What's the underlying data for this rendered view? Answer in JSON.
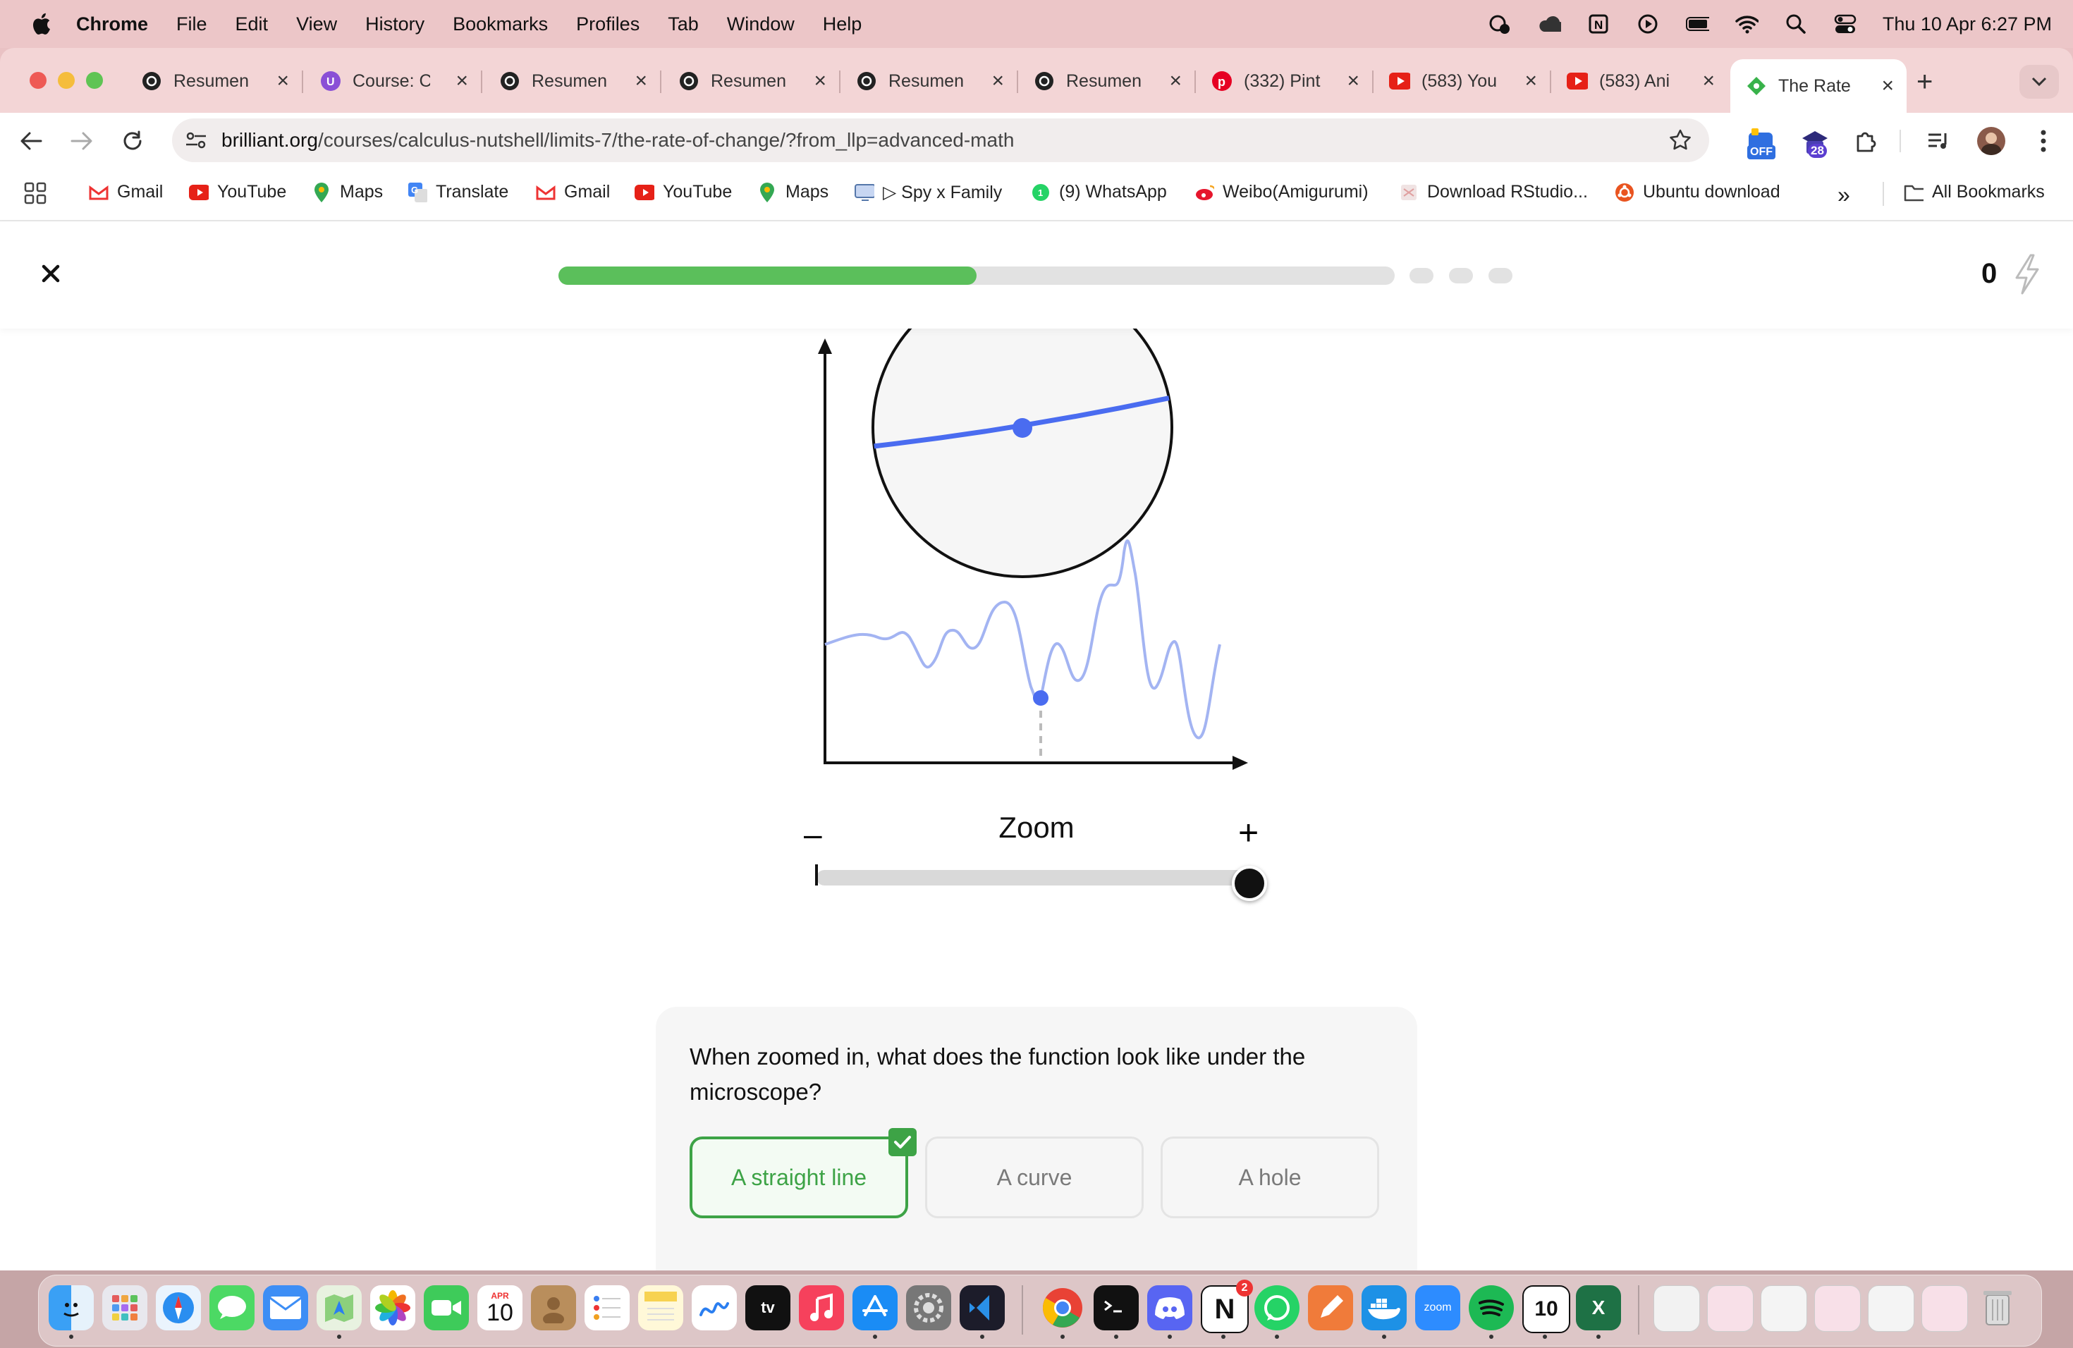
{
  "menubar": {
    "app_name": "Chrome",
    "items": [
      "File",
      "Edit",
      "View",
      "History",
      "Bookmarks",
      "Profiles",
      "Tab",
      "Window",
      "Help"
    ],
    "datetime": "Thu 10 Apr  6:27 PM"
  },
  "tabs": [
    {
      "title": "Resumen",
      "icon": "chatgpt-icon"
    },
    {
      "title": "Course: C",
      "icon": "udemy-icon"
    },
    {
      "title": "Resumen",
      "icon": "chatgpt-icon"
    },
    {
      "title": "Resumen",
      "icon": "chatgpt-icon"
    },
    {
      "title": "Resumen",
      "icon": "chatgpt-icon"
    },
    {
      "title": "Resumen",
      "icon": "chatgpt-icon"
    },
    {
      "title": "(332) Pint",
      "icon": "pinterest-icon"
    },
    {
      "title": "(583) You",
      "icon": "youtube-icon"
    },
    {
      "title": "(583) Ani",
      "icon": "youtube-icon"
    },
    {
      "title": "The Rate",
      "icon": "brilliant-icon",
      "active": true
    }
  ],
  "address": {
    "domain": "brilliant.org",
    "path": "/courses/calculus-nutshell/limits-7/the-rate-of-change/?from_llp=advanced-math"
  },
  "extensions": {
    "badge_off": "OFF",
    "badge_count": "28"
  },
  "bookmarks": [
    {
      "label": "Gmail",
      "icon": "gmail-icon"
    },
    {
      "label": "YouTube",
      "icon": "youtube-icon"
    },
    {
      "label": "Maps",
      "icon": "maps-icon"
    },
    {
      "label": "Translate",
      "icon": "translate-icon"
    },
    {
      "label": "Gmail",
      "icon": "gmail-icon"
    },
    {
      "label": "YouTube",
      "icon": "youtube-icon"
    },
    {
      "label": "Maps",
      "icon": "maps-icon"
    },
    {
      "label": "▷ Spy x Family",
      "icon": "tv-icon"
    },
    {
      "label": "(9) WhatsApp",
      "icon": "whatsapp-icon"
    },
    {
      "label": "Weibo(Amigurumi)",
      "icon": "weibo-icon"
    },
    {
      "label": "Download RStudio...",
      "icon": "rstudio-icon"
    },
    {
      "label": "Ubuntu download",
      "icon": "ubuntu-icon"
    }
  ],
  "bookmarks_more": "»",
  "all_bookmarks": "All Bookmarks",
  "lesson": {
    "progress_fraction": 0.5,
    "remaining_steps": 3,
    "score": "0"
  },
  "zoom": {
    "label": "Zoom",
    "minus": "–",
    "plus": "+",
    "level_fraction": 1.0
  },
  "question": {
    "text": "When zoomed in, what does the function look like under the microscope?",
    "options": [
      {
        "label": "A straight line",
        "selected": true
      },
      {
        "label": "A curve",
        "selected": false
      },
      {
        "label": "A hole",
        "selected": false
      }
    ]
  },
  "colors": {
    "accent_green": "#3da346",
    "progress_green": "#5bbf5b",
    "curve_blue": "#4a6cf0",
    "curve_light": "#a3b4f2"
  },
  "dock": {
    "calendar_month": "APR",
    "calendar_day": "10",
    "messages_badge": "2",
    "zoom_label": "zoom"
  }
}
